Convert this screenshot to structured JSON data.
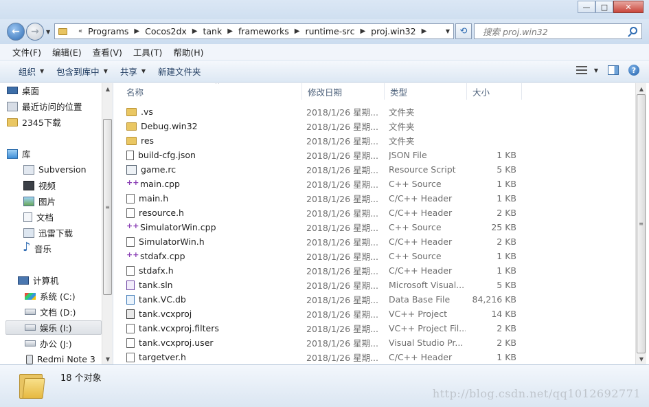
{
  "window": {
    "minimize_glyph": "—",
    "maximize_glyph": "□",
    "close_glyph": "✕"
  },
  "address": {
    "overflow": "«",
    "crumbs": [
      "Programs",
      "Cocos2dx",
      "tank",
      "frameworks",
      "runtime-src",
      "proj.win32"
    ],
    "search_placeholder": "搜索 proj.win32"
  },
  "menu": [
    "文件(F)",
    "编辑(E)",
    "查看(V)",
    "工具(T)",
    "帮助(H)"
  ],
  "toolbar": {
    "organize": "组织",
    "include_library": "包含到库中",
    "share": "共享",
    "new_folder": "新建文件夹"
  },
  "nav": {
    "favorites": [
      "桌面",
      "最近访问的位置",
      "2345下载"
    ],
    "libraries_label": "库",
    "libraries": [
      "Subversion",
      "视频",
      "图片",
      "文档",
      "迅雷下载",
      "音乐"
    ],
    "computer_label": "计算机",
    "drives": [
      "系统 (C:)",
      "文档 (D:)",
      "娱乐 (I:)",
      "办公 (J:)",
      "Redmi Note 3"
    ]
  },
  "columns": {
    "name": "名称",
    "date": "修改日期",
    "type": "类型",
    "size": "大小"
  },
  "files": [
    {
      "name": ".vs",
      "date": "2018/1/26 星期...",
      "type": "文件夹",
      "size": "",
      "icon": "folder-icon"
    },
    {
      "name": "Debug.win32",
      "date": "2018/1/26 星期...",
      "type": "文件夹",
      "size": "",
      "icon": "folder-icon"
    },
    {
      "name": "res",
      "date": "2018/1/26 星期...",
      "type": "文件夹",
      "size": "",
      "icon": "folder-icon"
    },
    {
      "name": "build-cfg.json",
      "date": "2018/1/26 星期...",
      "type": "JSON File",
      "size": "1 KB",
      "icon": "json-file-icon"
    },
    {
      "name": "game.rc",
      "date": "2018/1/26 星期...",
      "type": "Resource Script",
      "size": "5 KB",
      "icon": "resource-file-icon"
    },
    {
      "name": "main.cpp",
      "date": "2018/1/26 星期...",
      "type": "C++ Source",
      "size": "1 KB",
      "icon": "cpp-file-icon"
    },
    {
      "name": "main.h",
      "date": "2018/1/26 星期...",
      "type": "C/C++ Header",
      "size": "1 KB",
      "icon": "header-file-icon"
    },
    {
      "name": "resource.h",
      "date": "2018/1/26 星期...",
      "type": "C/C++ Header",
      "size": "2 KB",
      "icon": "header-file-icon"
    },
    {
      "name": "SimulatorWin.cpp",
      "date": "2018/1/26 星期...",
      "type": "C++ Source",
      "size": "25 KB",
      "icon": "cpp-file-icon"
    },
    {
      "name": "SimulatorWin.h",
      "date": "2018/1/26 星期...",
      "type": "C/C++ Header",
      "size": "2 KB",
      "icon": "header-file-icon"
    },
    {
      "name": "stdafx.cpp",
      "date": "2018/1/26 星期...",
      "type": "C++ Source",
      "size": "1 KB",
      "icon": "cpp-file-icon"
    },
    {
      "name": "stdafx.h",
      "date": "2018/1/26 星期...",
      "type": "C/C++ Header",
      "size": "1 KB",
      "icon": "header-file-icon"
    },
    {
      "name": "tank.sln",
      "date": "2018/1/26 星期...",
      "type": "Microsoft Visual...",
      "size": "5 KB",
      "icon": "solution-file-icon"
    },
    {
      "name": "tank.VC.db",
      "date": "2018/1/26 星期...",
      "type": "Data Base File",
      "size": "84,216 KB",
      "icon": "database-file-icon"
    },
    {
      "name": "tank.vcxproj",
      "date": "2018/1/26 星期...",
      "type": "VC++ Project",
      "size": "14 KB",
      "icon": "vcxproj-file-icon"
    },
    {
      "name": "tank.vcxproj.filters",
      "date": "2018/1/26 星期...",
      "type": "VC++ Project Fil...",
      "size": "2 KB",
      "icon": "filters-file-icon"
    },
    {
      "name": "tank.vcxproj.user",
      "date": "2018/1/26 星期...",
      "type": "Visual Studio Pr...",
      "size": "2 KB",
      "icon": "user-file-icon"
    },
    {
      "name": "targetver.h",
      "date": "2018/1/26 星期...",
      "type": "C/C++ Header",
      "size": "1 KB",
      "icon": "header-file-icon"
    }
  ],
  "status": {
    "item_count": "18 个对象"
  },
  "watermark": "http://blog.csdn.net/qq1012692771",
  "colors": {
    "accent": "#2f6cb3",
    "annotation_arrow": "#d22020",
    "folder": "#eac763"
  }
}
